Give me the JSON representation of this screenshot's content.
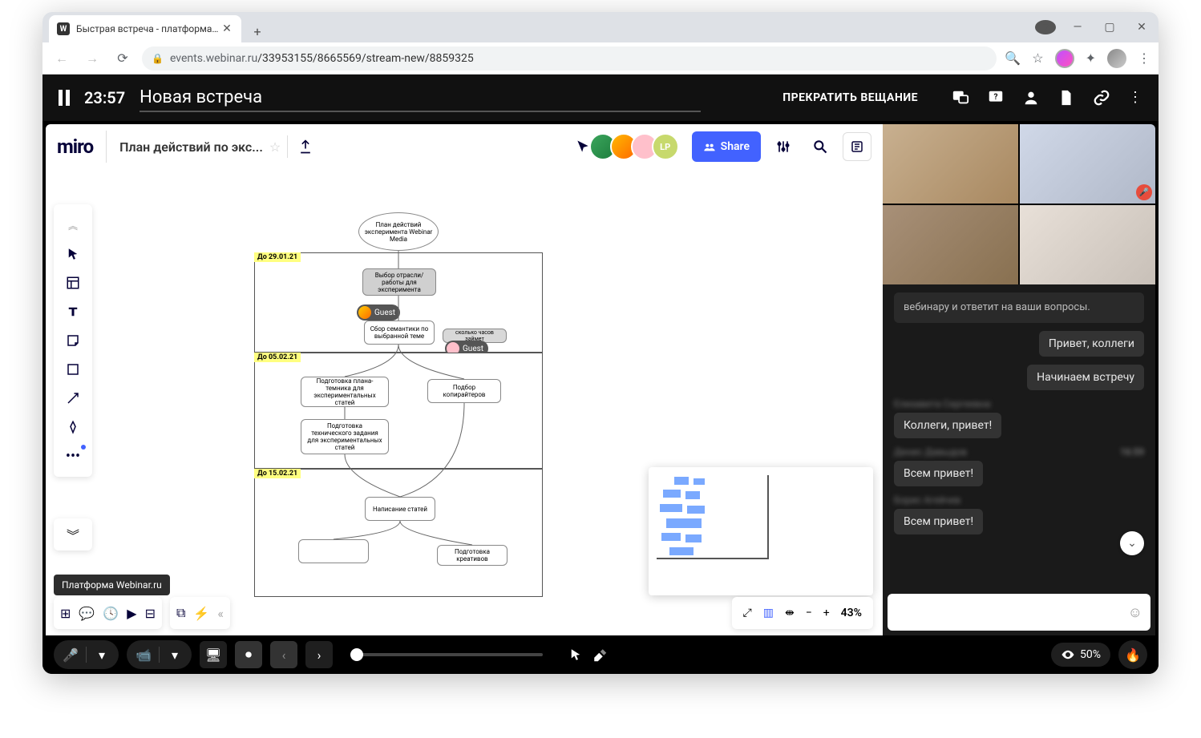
{
  "browser": {
    "tab_title": "Быстрая встреча - платформа W",
    "url_host": "events.webinar.ru",
    "url_path": "/33953155/8665569/stream-new/8859325"
  },
  "top_bar": {
    "timer": "23:57",
    "meeting_title": "Новая встреча",
    "stop_label": "ПРЕКРАТИТЬ ВЕЩАНИЕ"
  },
  "miro": {
    "logo": "miro",
    "board_name": "План действий по экс...",
    "share_label": "Share",
    "avatar4": "LP",
    "tooltip": "Платформа Webinar.ru",
    "zoom": "43%",
    "dates": {
      "d1": "До 29.01.21",
      "d2": "До 05.02.21",
      "d3": "До 15.02.21"
    },
    "nodes": {
      "ellipse": "План действий\nэксперимента\nWebinar Media",
      "branch": "Выбор отрасли/работы\nдля эксперимента",
      "semantics": "Сбор семантики по\nвыбранной теме",
      "hours": "сколько часов займет",
      "plan": "Подготовка плана-темника\nдля экспериментальных\nстатей",
      "copy": "Подбор копирайтеров",
      "tz": "Подготовка технического\nзадания\nдля экспериментальных\nстатей",
      "write": "Написание статей",
      "creative": "Подготовка креативов"
    },
    "guest": "Guest"
  },
  "chat": {
    "system": "вебинару и ответит на ваши вопросы.",
    "m1": "Привет, коллеги",
    "m2": "Начинаем встречу",
    "a3": "Елизавета Сергеевна",
    "m3": "Коллеги, привет!",
    "a4": "Денис Давыдов",
    "t4": "16:59",
    "m4": "Всем привет!",
    "a5": "Борис Агейчев",
    "m5": "Всем привет!",
    "input_placeholder": ""
  },
  "bottom": {
    "view_pct": "50%"
  }
}
